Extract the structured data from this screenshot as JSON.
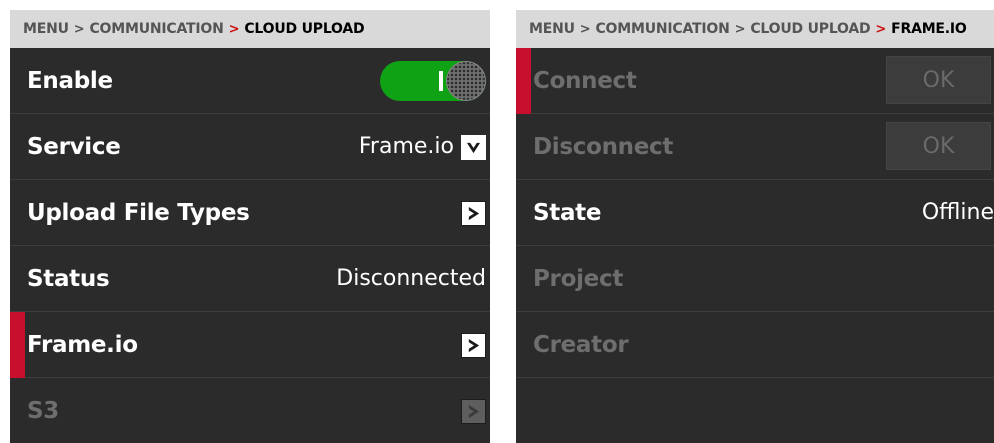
{
  "left_panel": {
    "breadcrumb": {
      "items": [
        "MENU",
        "COMMUNICATION"
      ],
      "current": "CLOUD UPLOAD",
      "separator": ">"
    },
    "rows": {
      "enable": {
        "label": "Enable",
        "toggle_state": "on"
      },
      "service": {
        "label": "Service",
        "value": "Frame.io",
        "icon": "chevron-down-icon"
      },
      "upload_file_types": {
        "label": "Upload File Types",
        "icon": "chevron-right-icon"
      },
      "status": {
        "label": "Status",
        "value": "Disconnected"
      },
      "frameio": {
        "label": "Frame.io",
        "icon": "chevron-right-icon",
        "selected": true
      },
      "s3": {
        "label": "S3",
        "icon": "chevron-right-icon",
        "disabled": true
      }
    }
  },
  "right_panel": {
    "breadcrumb": {
      "items": [
        "MENU",
        "COMMUNICATION",
        "CLOUD UPLOAD"
      ],
      "current": "FRAME.IO",
      "separator": ">"
    },
    "rows": {
      "connect": {
        "label": "Connect",
        "button": "OK",
        "disabled": true,
        "selected": true
      },
      "disconnect": {
        "label": "Disconnect",
        "button": "OK",
        "disabled": true
      },
      "state": {
        "label": "State",
        "value": "Offline"
      },
      "project": {
        "label": "Project",
        "disabled": true
      },
      "creator": {
        "label": "Creator",
        "disabled": true
      }
    }
  },
  "colors": {
    "panel_bg": "#2b2b2b",
    "breadcrumb_bg": "#d9d9d9",
    "accent_red": "#c8102e",
    "toggle_on": "#0fa214",
    "disabled_text": "#6e6e6e"
  }
}
